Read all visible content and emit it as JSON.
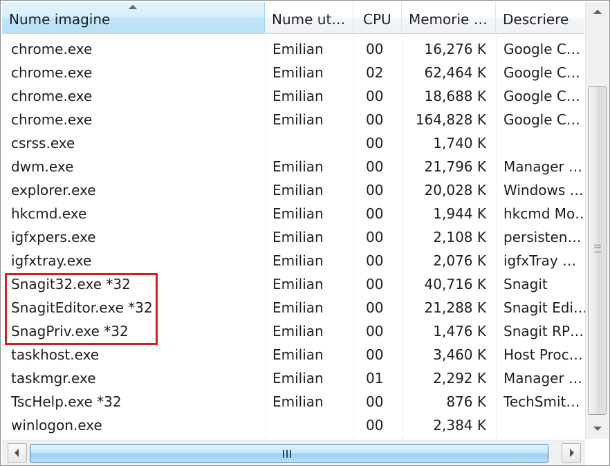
{
  "columns": {
    "name": "Nume imagine",
    "user": "Nume ut…",
    "cpu": "CPU",
    "memory": "Memorie …",
    "description": "Descriere"
  },
  "rows": [
    {
      "name": "chrome.exe",
      "user": "Emilian",
      "cpu": "00",
      "memory": "16,276 K",
      "description": "Google C…"
    },
    {
      "name": "chrome.exe",
      "user": "Emilian",
      "cpu": "02",
      "memory": "62,464 K",
      "description": "Google C…"
    },
    {
      "name": "chrome.exe",
      "user": "Emilian",
      "cpu": "00",
      "memory": "18,688 K",
      "description": "Google C…"
    },
    {
      "name": "chrome.exe",
      "user": "Emilian",
      "cpu": "00",
      "memory": "164,828 K",
      "description": "Google C…"
    },
    {
      "name": "csrss.exe",
      "user": "",
      "cpu": "00",
      "memory": "1,740 K",
      "description": ""
    },
    {
      "name": "dwm.exe",
      "user": "Emilian",
      "cpu": "00",
      "memory": "21,796 K",
      "description": "Manager …"
    },
    {
      "name": "explorer.exe",
      "user": "Emilian",
      "cpu": "00",
      "memory": "20,028 K",
      "description": "Windows …"
    },
    {
      "name": "hkcmd.exe",
      "user": "Emilian",
      "cpu": "00",
      "memory": "1,944 K",
      "description": "hkcmd Mo…"
    },
    {
      "name": "igfxpers.exe",
      "user": "Emilian",
      "cpu": "00",
      "memory": "2,108 K",
      "description": "persisten…"
    },
    {
      "name": "igfxtray.exe",
      "user": "Emilian",
      "cpu": "00",
      "memory": "2,076 K",
      "description": "igfxTray …"
    },
    {
      "name": "Snagit32.exe *32",
      "user": "Emilian",
      "cpu": "00",
      "memory": "40,716 K",
      "description": "Snagit"
    },
    {
      "name": "SnagitEditor.exe *32",
      "user": "Emilian",
      "cpu": "00",
      "memory": "21,288 K",
      "description": "Snagit Edi…"
    },
    {
      "name": "SnagPriv.exe *32",
      "user": "Emilian",
      "cpu": "00",
      "memory": "1,476 K",
      "description": "Snagit RP…"
    },
    {
      "name": "taskhost.exe",
      "user": "Emilian",
      "cpu": "00",
      "memory": "3,460 K",
      "description": "Host Proc…"
    },
    {
      "name": "taskmgr.exe",
      "user": "Emilian",
      "cpu": "01",
      "memory": "2,292 K",
      "description": "Manager …"
    },
    {
      "name": "TscHelp.exe *32",
      "user": "Emilian",
      "cpu": "00",
      "memory": "876 K",
      "description": "TechSmit…"
    },
    {
      "name": "winlogon.exe",
      "user": "",
      "cpu": "00",
      "memory": "2,384 K",
      "description": ""
    }
  ],
  "highlighted_rows": [
    10,
    11,
    12
  ],
  "colors": {
    "highlight_border": "#d21f1f",
    "sorted_header": "#d8effc"
  },
  "icons": {
    "sort": "sort-ascending-icon",
    "scroll_up": "scroll-up-arrow-icon",
    "scroll_down": "scroll-down-arrow-icon",
    "scroll_left": "scroll-left-arrow-icon",
    "scroll_right": "scroll-right-arrow-icon"
  }
}
